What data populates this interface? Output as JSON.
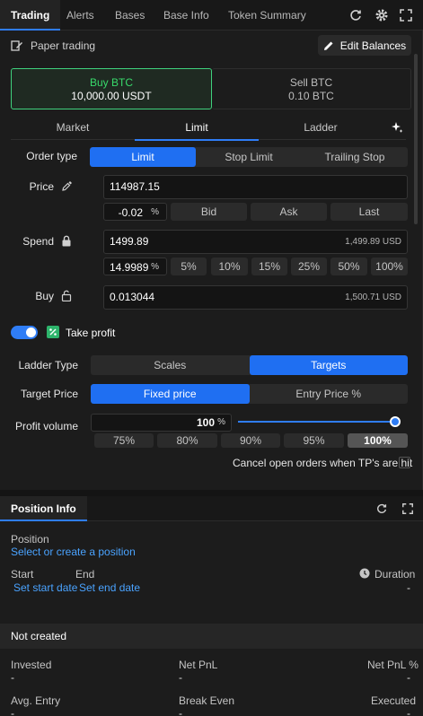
{
  "header": {
    "tabs": [
      "Trading",
      "Alerts",
      "Bases",
      "Base Info",
      "Token Summary"
    ],
    "icons": [
      "refresh-icon",
      "gear-icon",
      "expand-icon"
    ]
  },
  "mode": {
    "label": "Paper trading",
    "edit_balances": "Edit Balances"
  },
  "sides": {
    "buy": {
      "title": "Buy BTC",
      "balance": "10,000.00 USDT"
    },
    "sell": {
      "title": "Sell BTC",
      "balance": "0.10 BTC"
    }
  },
  "order_tabs": [
    "Market",
    "Limit",
    "Ladder"
  ],
  "order_type": {
    "label": "Order type",
    "options": [
      "Limit",
      "Stop Limit",
      "Trailing Stop"
    ],
    "selected": "Limit"
  },
  "price": {
    "label": "Price",
    "value": "114987.15",
    "offset": "-0.02",
    "offset_unit": "%",
    "quick": [
      "Bid",
      "Ask",
      "Last"
    ]
  },
  "spend": {
    "label": "Spend",
    "value": "1499.89",
    "hint": "1,499.89 USD",
    "percent": "14.9989",
    "percent_unit": "%",
    "quick": [
      "5%",
      "10%",
      "15%",
      "25%",
      "50%",
      "100%"
    ]
  },
  "buy": {
    "label": "Buy",
    "value": "0.013044",
    "hint": "1,500.71 USD"
  },
  "take_profit": {
    "label": "Take profit",
    "enabled": true
  },
  "ladder_type": {
    "label": "Ladder Type",
    "options": [
      "Scales",
      "Targets"
    ],
    "selected": "Targets"
  },
  "target_price": {
    "label": "Target Price",
    "options": [
      "Fixed price",
      "Entry Price %"
    ],
    "selected": "Fixed price"
  },
  "profit_volume": {
    "label": "Profit volume",
    "value": "100",
    "unit": "%",
    "level": 1.0,
    "quick": [
      "75%",
      "80%",
      "90%",
      "95%",
      "100%"
    ],
    "selected": "100%"
  },
  "cancel_orders": {
    "label": "Cancel open orders when TP's are hit",
    "checked": false
  },
  "position": {
    "tab": "Position Info",
    "position_label": "Position",
    "position_link": "Select or create a position",
    "start_label": "Start",
    "end_label": "End",
    "start_link": "Set start date",
    "end_link": "Set end date",
    "duration_label": "Duration",
    "duration_value": "-",
    "status": "Not created",
    "stats": [
      {
        "label": "Invested",
        "value": "-"
      },
      {
        "label": "Net PnL",
        "value": "-"
      },
      {
        "label": "Net PnL %",
        "value": "-"
      },
      {
        "label": "Avg. Entry",
        "value": "-"
      },
      {
        "label": "Break Even",
        "value": "-"
      },
      {
        "label": "Executed",
        "value": "-"
      }
    ]
  },
  "colors": {
    "accent": "#2f7df6",
    "buy_green": "#38d96b",
    "link": "#4aa3ff"
  }
}
